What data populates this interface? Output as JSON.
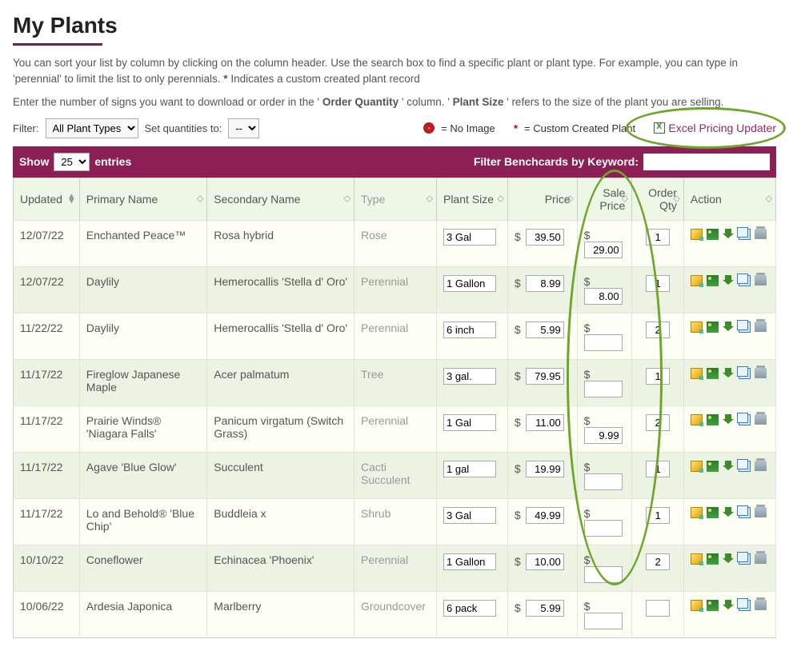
{
  "page": {
    "title": "My Plants",
    "intro_line1_a": "You can sort your list by column by clicking on the column header.  Use the search box to find a specific plant or plant type. For example, you can type in 'perennial' to limit the list to only perennials.  ",
    "intro_asterisk": "*",
    "intro_line1_b": " Indicates a custom created plant record",
    "intro_line2_a": "Enter the number of signs you want to download or order in the '",
    "intro_line2_oq": "Order Quantity",
    "intro_line2_b": "' column. '",
    "intro_line2_ps": "Plant Size",
    "intro_line2_c": "' refers to the size of the plant you are selling."
  },
  "controls": {
    "filter_label": "Filter:",
    "filter_option": "All Plant Types",
    "set_qty_label": "Set quantities to:",
    "set_qty_option": "--",
    "no_image_legend": " = No Image",
    "custom_legend": " = Custom Created Plant",
    "excel_link": "Excel Pricing Updater"
  },
  "table_header": {
    "show_text": "Show ",
    "entries_text": " entries",
    "show_value": "25",
    "filter_kw_label": "Filter Benchcards by Keyword:"
  },
  "columns": {
    "updated": "Updated",
    "primary": "Primary Name",
    "secondary": "Secondary Name",
    "type": "Type",
    "plant_size": "Plant Size",
    "price": "Price",
    "sale_price": "Sale Price",
    "order_qty": "Order Qty",
    "action": "Action"
  },
  "rows": [
    {
      "updated": "12/07/22",
      "primary": "Enchanted Peace™",
      "secondary": "Rosa hybrid",
      "type": "Rose",
      "plant_size": "3 Gal",
      "price": "39.50",
      "sale_price": "29.00",
      "order_qty": "1"
    },
    {
      "updated": "12/07/22",
      "primary": "Daylily",
      "secondary": "Hemerocallis 'Stella d' Oro'",
      "type": "Perennial",
      "plant_size": "1 Gallon",
      "price": "8.99",
      "sale_price": "8.00",
      "order_qty": "1"
    },
    {
      "updated": "11/22/22",
      "primary": "Daylily",
      "secondary": "Hemerocallis 'Stella d' Oro'",
      "type": "Perennial",
      "plant_size": "6 inch",
      "price": "5.99",
      "sale_price": "",
      "order_qty": "2"
    },
    {
      "updated": "11/17/22",
      "primary": "Fireglow Japanese Maple",
      "secondary": "Acer palmatum",
      "type": "Tree",
      "plant_size": "3 gal.",
      "price": "79.95",
      "sale_price": "",
      "order_qty": "1"
    },
    {
      "updated": "11/17/22",
      "primary": "Prairie Winds® 'Niagara Falls'",
      "secondary": "Panicum virgatum (Switch Grass)",
      "type": "Perennial",
      "plant_size": "1 Gal",
      "price": "11.00",
      "sale_price": "9.99",
      "order_qty": "2"
    },
    {
      "updated": "11/17/22",
      "primary": "Agave 'Blue Glow'",
      "secondary": "Succulent",
      "type": "Cacti Succulent",
      "plant_size": "1 gal",
      "price": "19.99",
      "sale_price": "",
      "order_qty": "1"
    },
    {
      "updated": "11/17/22",
      "primary": "Lo and Behold® 'Blue Chip'",
      "secondary": "Buddleia x",
      "type": "Shrub",
      "plant_size": "3 Gal",
      "price": "49.99",
      "sale_price": "",
      "order_qty": "1"
    },
    {
      "updated": "10/10/22",
      "primary": "Coneflower",
      "secondary": "Echinacea 'Phoenix'",
      "type": "Perennial",
      "plant_size": "1 Gallon",
      "price": "10.00",
      "sale_price": "",
      "order_qty": "2"
    },
    {
      "updated": "10/06/22",
      "primary": "Ardesia Japonica",
      "secondary": "Marlberry",
      "type": "Groundcover",
      "plant_size": "6 pack",
      "price": "5.99",
      "sale_price": "",
      "order_qty": ""
    }
  ]
}
